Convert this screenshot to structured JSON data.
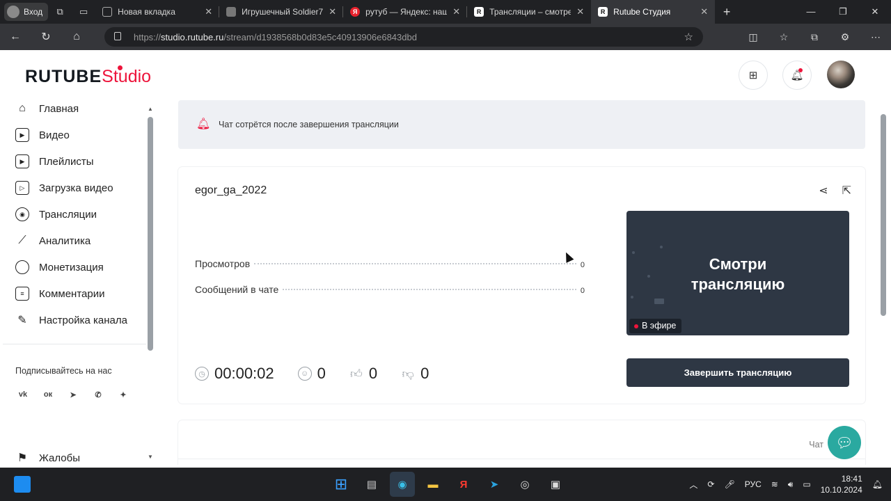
{
  "browser": {
    "profile_label": "Вход",
    "tabs": [
      {
        "title": "Новая вкладка",
        "favicon": "new-tab-icon",
        "active": false
      },
      {
        "title": "Игрушечный Soldier7",
        "favicon": "site-icon",
        "active": false
      },
      {
        "title": "рутуб — Яндекс: наш",
        "favicon": "yandex-icon",
        "active": false
      },
      {
        "title": "Трансляции – смотре",
        "favicon": "rutube-icon",
        "active": false
      },
      {
        "title": "Rutube Студия",
        "favicon": "rutube-icon",
        "active": true
      }
    ],
    "url_prefix": "https://",
    "url_host": "studio.rutube.ru",
    "url_path": "/stream/d1938568b0d83e5c40913906e6843dbd"
  },
  "header": {
    "logo_main": "RUTUBE",
    "logo_studio": "Studio"
  },
  "sidebar": {
    "items": [
      {
        "label": "Главная",
        "icon": "home-icon"
      },
      {
        "label": "Видео",
        "icon": "video-icon"
      },
      {
        "label": "Плейлисты",
        "icon": "playlist-icon"
      },
      {
        "label": "Загрузка видео",
        "icon": "upload-video-icon"
      },
      {
        "label": "Трансляции",
        "icon": "broadcast-icon"
      },
      {
        "label": "Аналитика",
        "icon": "analytics-icon"
      },
      {
        "label": "Монетизация",
        "icon": "monetization-icon"
      },
      {
        "label": "Комментарии",
        "icon": "comments-icon"
      },
      {
        "label": "Настройка канала",
        "icon": "channel-settings-icon"
      }
    ],
    "subscribe_label": "Подписывайтесь на нас",
    "socials": [
      "vk",
      "ok",
      "telegram",
      "viber",
      "more"
    ],
    "complaints_label": "Жалобы"
  },
  "alert": {
    "text": "Чат сотрётся после завершения трансляции"
  },
  "stream": {
    "channel_name": "egor_ga_2022",
    "views_label": "Просмотров",
    "views_value": "0",
    "messages_label": "Сообщений в чате",
    "messages_value": "0",
    "duration": "00:00:02",
    "viewers": "0",
    "likes": "0",
    "dislikes": "0",
    "preview_text": "Смотри трансляцию",
    "live_label": "В эфире",
    "end_button": "Завершить трансляцию"
  },
  "chat": {
    "label": "Чат"
  },
  "taskbar": {
    "lang": "РУС",
    "time": "18:41",
    "date": "10.10.2024"
  },
  "colors": {
    "brand_red": "#ed143b",
    "dark_button": "#2e3744",
    "support_teal": "#2aa9a0"
  }
}
